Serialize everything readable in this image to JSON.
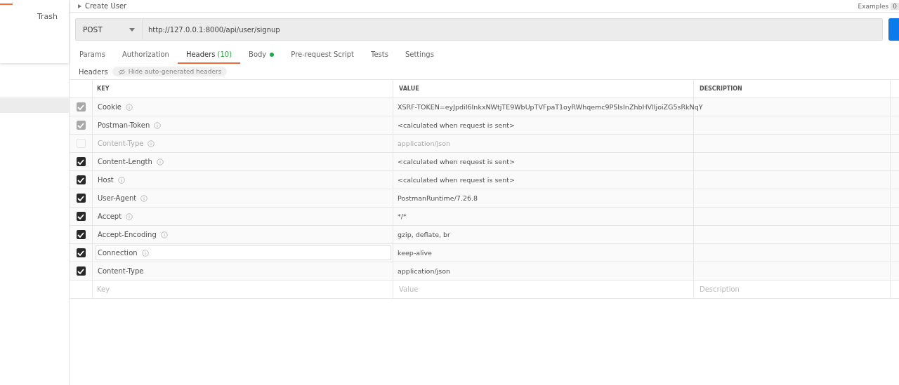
{
  "sidebar": {
    "items": [
      {
        "label": "Trash"
      }
    ]
  },
  "request": {
    "title": "Create User",
    "examples_label": "Examples",
    "examples_count": "0",
    "method": "POST",
    "url": "http://127.0.0.1:8000/api/user/signup"
  },
  "tabs": [
    {
      "label": "Params",
      "selected": false
    },
    {
      "label": "Authorization",
      "selected": false
    },
    {
      "label": "Headers",
      "count": "(10)",
      "selected": true
    },
    {
      "label": "Body",
      "dot": true,
      "selected": false
    },
    {
      "label": "Pre-request Script",
      "selected": false
    },
    {
      "label": "Tests",
      "selected": false
    },
    {
      "label": "Settings",
      "selected": false
    }
  ],
  "headers_bar": {
    "label": "Headers",
    "toggle": "Hide auto-generated headers"
  },
  "table": {
    "columns": [
      "KEY",
      "VALUE",
      "DESCRIPTION"
    ],
    "rows": [
      {
        "key": "Cookie",
        "value": "XSRF-TOKEN=eyJpdiI6InkxNWtjTE9WbUpTVFpaT1oyRWhqemc9PSIsInZhbHVlIjoiZG5sRkNqY",
        "checked": true,
        "kind": "auto",
        "info": true,
        "focused": false
      },
      {
        "key": "Postman-Token",
        "value": "<calculated when request is sent>",
        "checked": true,
        "kind": "auto",
        "info": true,
        "focused": false
      },
      {
        "key": "Content-Type",
        "value": "application/json",
        "checked": false,
        "kind": "auto",
        "info": true,
        "focused": false
      },
      {
        "key": "Content-Length",
        "value": "<calculated when request is sent>",
        "checked": true,
        "kind": "user",
        "info": true,
        "focused": false
      },
      {
        "key": "Host",
        "value": "<calculated when request is sent>",
        "checked": true,
        "kind": "user",
        "info": true,
        "focused": false
      },
      {
        "key": "User-Agent",
        "value": "PostmanRuntime/7.26.8",
        "checked": true,
        "kind": "user",
        "info": true,
        "focused": false
      },
      {
        "key": "Accept",
        "value": "*/*",
        "checked": true,
        "kind": "user",
        "info": true,
        "focused": false
      },
      {
        "key": "Accept-Encoding",
        "value": "gzip, deflate, br",
        "checked": true,
        "kind": "user",
        "info": true,
        "focused": false
      },
      {
        "key": "Connection",
        "value": "keep-alive",
        "checked": true,
        "kind": "user",
        "info": true,
        "focused": true
      },
      {
        "key": "Content-Type",
        "value": "application/json",
        "checked": true,
        "kind": "user",
        "info": false,
        "focused": false
      }
    ],
    "new_row": {
      "key_placeholder": "Key",
      "value_placeholder": "Value",
      "description_placeholder": "Description"
    }
  }
}
